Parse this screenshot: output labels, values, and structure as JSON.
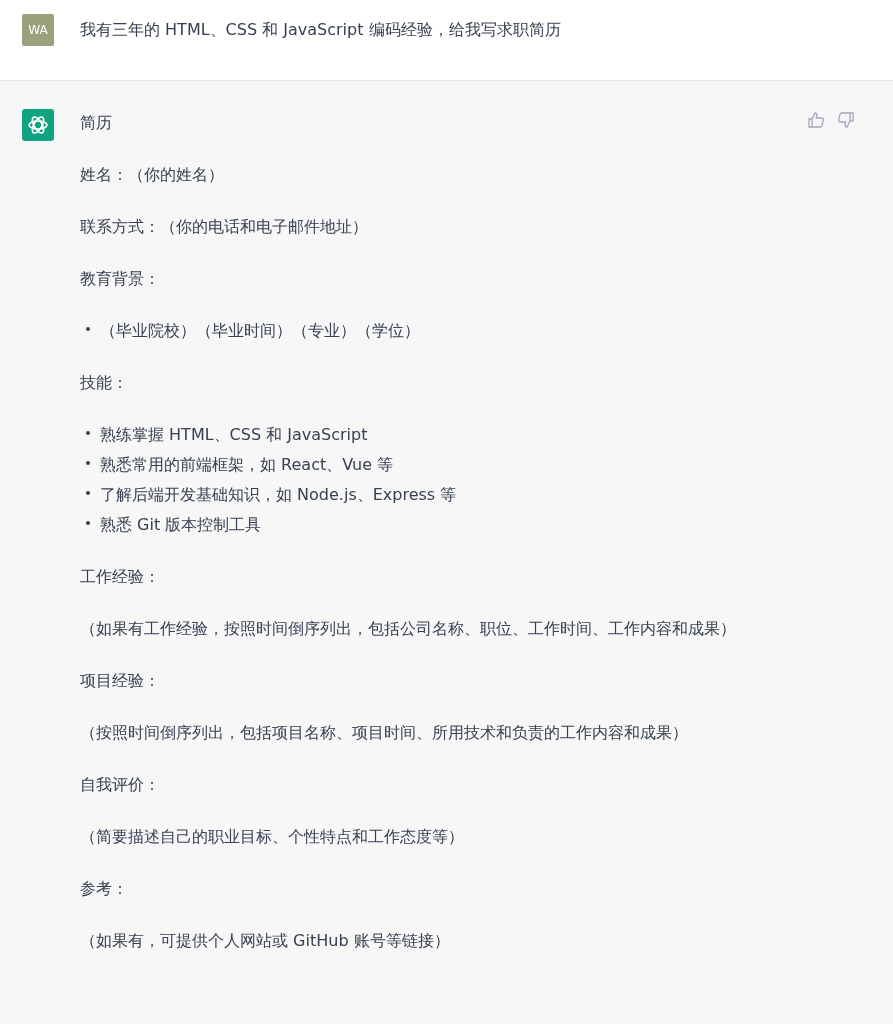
{
  "user_message": {
    "avatar": "WA",
    "text": "我有三年的 HTML、CSS 和 JavaScript 编码经验，给我写求职简历"
  },
  "assistant_message": {
    "blocks": [
      {
        "kind": "paragraph",
        "text": "简历"
      },
      {
        "kind": "paragraph",
        "text": "姓名：（你的姓名）"
      },
      {
        "kind": "paragraph",
        "text": "联系方式：（你的电话和电子邮件地址）"
      },
      {
        "kind": "paragraph",
        "text": "教育背景："
      },
      {
        "kind": "list",
        "items": [
          "（毕业院校）（毕业时间）（专业）（学位）"
        ]
      },
      {
        "kind": "paragraph",
        "text": "技能："
      },
      {
        "kind": "list",
        "items": [
          "熟练掌握 HTML、CSS 和 JavaScript",
          "熟悉常用的前端框架，如 React、Vue 等",
          "了解后端开发基础知识，如 Node.js、Express 等",
          "熟悉 Git 版本控制工具"
        ]
      },
      {
        "kind": "paragraph",
        "text": "工作经验："
      },
      {
        "kind": "paragraph",
        "text": "（如果有工作经验，按照时间倒序列出，包括公司名称、职位、工作时间、工作内容和成果）"
      },
      {
        "kind": "paragraph",
        "text": "项目经验："
      },
      {
        "kind": "paragraph",
        "text": "（按照时间倒序列出，包括项目名称、项目时间、所用技术和负责的工作内容和成果）"
      },
      {
        "kind": "paragraph",
        "text": "自我评价："
      },
      {
        "kind": "paragraph",
        "text": "（简要描述自己的职业目标、个性特点和工作态度等）"
      },
      {
        "kind": "paragraph",
        "text": "参考："
      },
      {
        "kind": "paragraph",
        "text": "（如果有，可提供个人网站或 GitHub 账号等链接）"
      }
    ]
  }
}
